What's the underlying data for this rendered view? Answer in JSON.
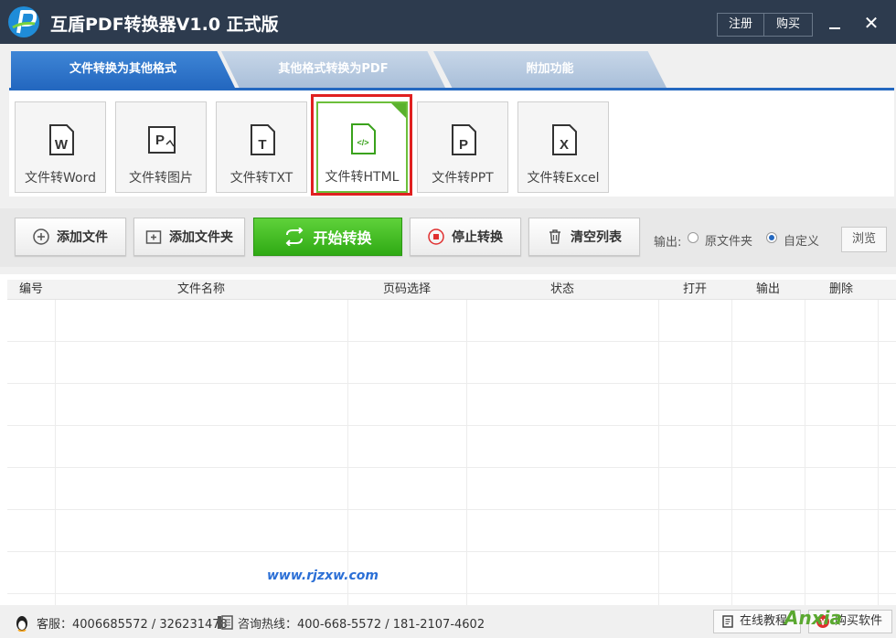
{
  "window": {
    "title": "互盾PDF转换器V1.0 正式版",
    "register_label": "注册",
    "buy_label": "购买",
    "minimize_icon": "minimize-icon",
    "close_glyph": "✕"
  },
  "tabs": [
    {
      "label": "文件转换为其他格式",
      "active": true
    },
    {
      "label": "其他格式转换为PDF",
      "active": false
    },
    {
      "label": "附加功能",
      "active": false
    }
  ],
  "tiles": [
    {
      "label": "文件转Word",
      "icon": "word-file-icon",
      "glyph": "W"
    },
    {
      "label": "文件转图片",
      "icon": "image-file-icon",
      "glyph": "P"
    },
    {
      "label": "文件转TXT",
      "icon": "txt-file-icon",
      "glyph": "T"
    },
    {
      "label": "文件转HTML",
      "icon": "html-file-icon",
      "glyph": "</>",
      "active": true
    },
    {
      "label": "文件转PPT",
      "icon": "ppt-file-icon",
      "glyph": "P"
    },
    {
      "label": "文件转Excel",
      "icon": "excel-file-icon",
      "glyph": "X"
    }
  ],
  "toolbar": {
    "add_file": "添加文件",
    "add_folder": "添加文件夹",
    "start": "开始转换",
    "stop": "停止转换",
    "clear": "清空列表",
    "output_label": "输出:",
    "output_options": [
      "原文件夹",
      "自定义"
    ],
    "output_selected": "自定义",
    "browse": "浏览"
  },
  "table": {
    "columns": [
      "编号",
      "文件名称",
      "页码选择",
      "状态",
      "打开",
      "输出",
      "删除"
    ],
    "rows": []
  },
  "watermark": "www.rjzxw.com",
  "statusbar": {
    "service": "客服：4006685572 / 326231478",
    "hotline": "咨询热线：400-668-5572 / 181-2107-4602",
    "tutorial": "在线教程",
    "buy_software": "购买软件",
    "corner_watermark": "Anxia"
  },
  "colors": {
    "titlebar": "#2d3b4e",
    "tab_active": "#2468c0",
    "start_button": "#2faa14",
    "highlight": "#e02020",
    "active_tile_border": "#6cbf3b"
  }
}
